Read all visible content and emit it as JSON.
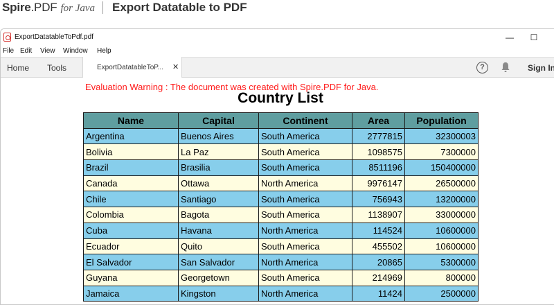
{
  "banner": {
    "brand_main": "Spire",
    "brand_dot": ".PDF",
    "brand_sub": "for Java",
    "title": "Export Datatable to PDF"
  },
  "window": {
    "title": "ExportDatatableToPdf.pdf",
    "minimize": "—",
    "maximize": "☐"
  },
  "menu": [
    "File",
    "Edit",
    "View",
    "Window",
    "Help"
  ],
  "tabs": {
    "home": "Home",
    "tools": "Tools",
    "document": "ExportDatatableToP...",
    "close": "✕",
    "help": "?",
    "signin": "Sign In"
  },
  "document": {
    "warning": "Evaluation Warning : The document was created with Spire.PDF for Java.",
    "title": "Country List",
    "table": {
      "headers": [
        "Name",
        "Capital",
        "Continent",
        "Area",
        "Population"
      ],
      "rows": [
        [
          "Argentina",
          "Buenos Aires",
          "South America",
          "2777815",
          "32300003"
        ],
        [
          "Bolivia",
          "La Paz",
          "South America",
          "1098575",
          "7300000"
        ],
        [
          "Brazil",
          "Brasilia",
          "South America",
          "8511196",
          "150400000"
        ],
        [
          "Canada",
          "Ottawa",
          "North America",
          "9976147",
          "26500000"
        ],
        [
          "Chile",
          "Santiago",
          "South America",
          "756943",
          "13200000"
        ],
        [
          "Colombia",
          "Bagota",
          "South America",
          "1138907",
          "33000000"
        ],
        [
          "Cuba",
          "Havana",
          "North America",
          "114524",
          "10600000"
        ],
        [
          "Ecuador",
          "Quito",
          "South America",
          "455502",
          "10600000"
        ],
        [
          "El Salvador",
          "San Salvador",
          "North America",
          "20865",
          "5300000"
        ],
        [
          "Guyana",
          "Georgetown",
          "South America",
          "214969",
          "800000"
        ],
        [
          "Jamaica",
          "Kingston",
          "North America",
          "11424",
          "2500000"
        ]
      ]
    }
  },
  "colors": {
    "header_bg": "#5f9ea0",
    "row_odd": "#87ceeb",
    "row_even": "#fffde0",
    "warning": "#ff1a1a"
  }
}
